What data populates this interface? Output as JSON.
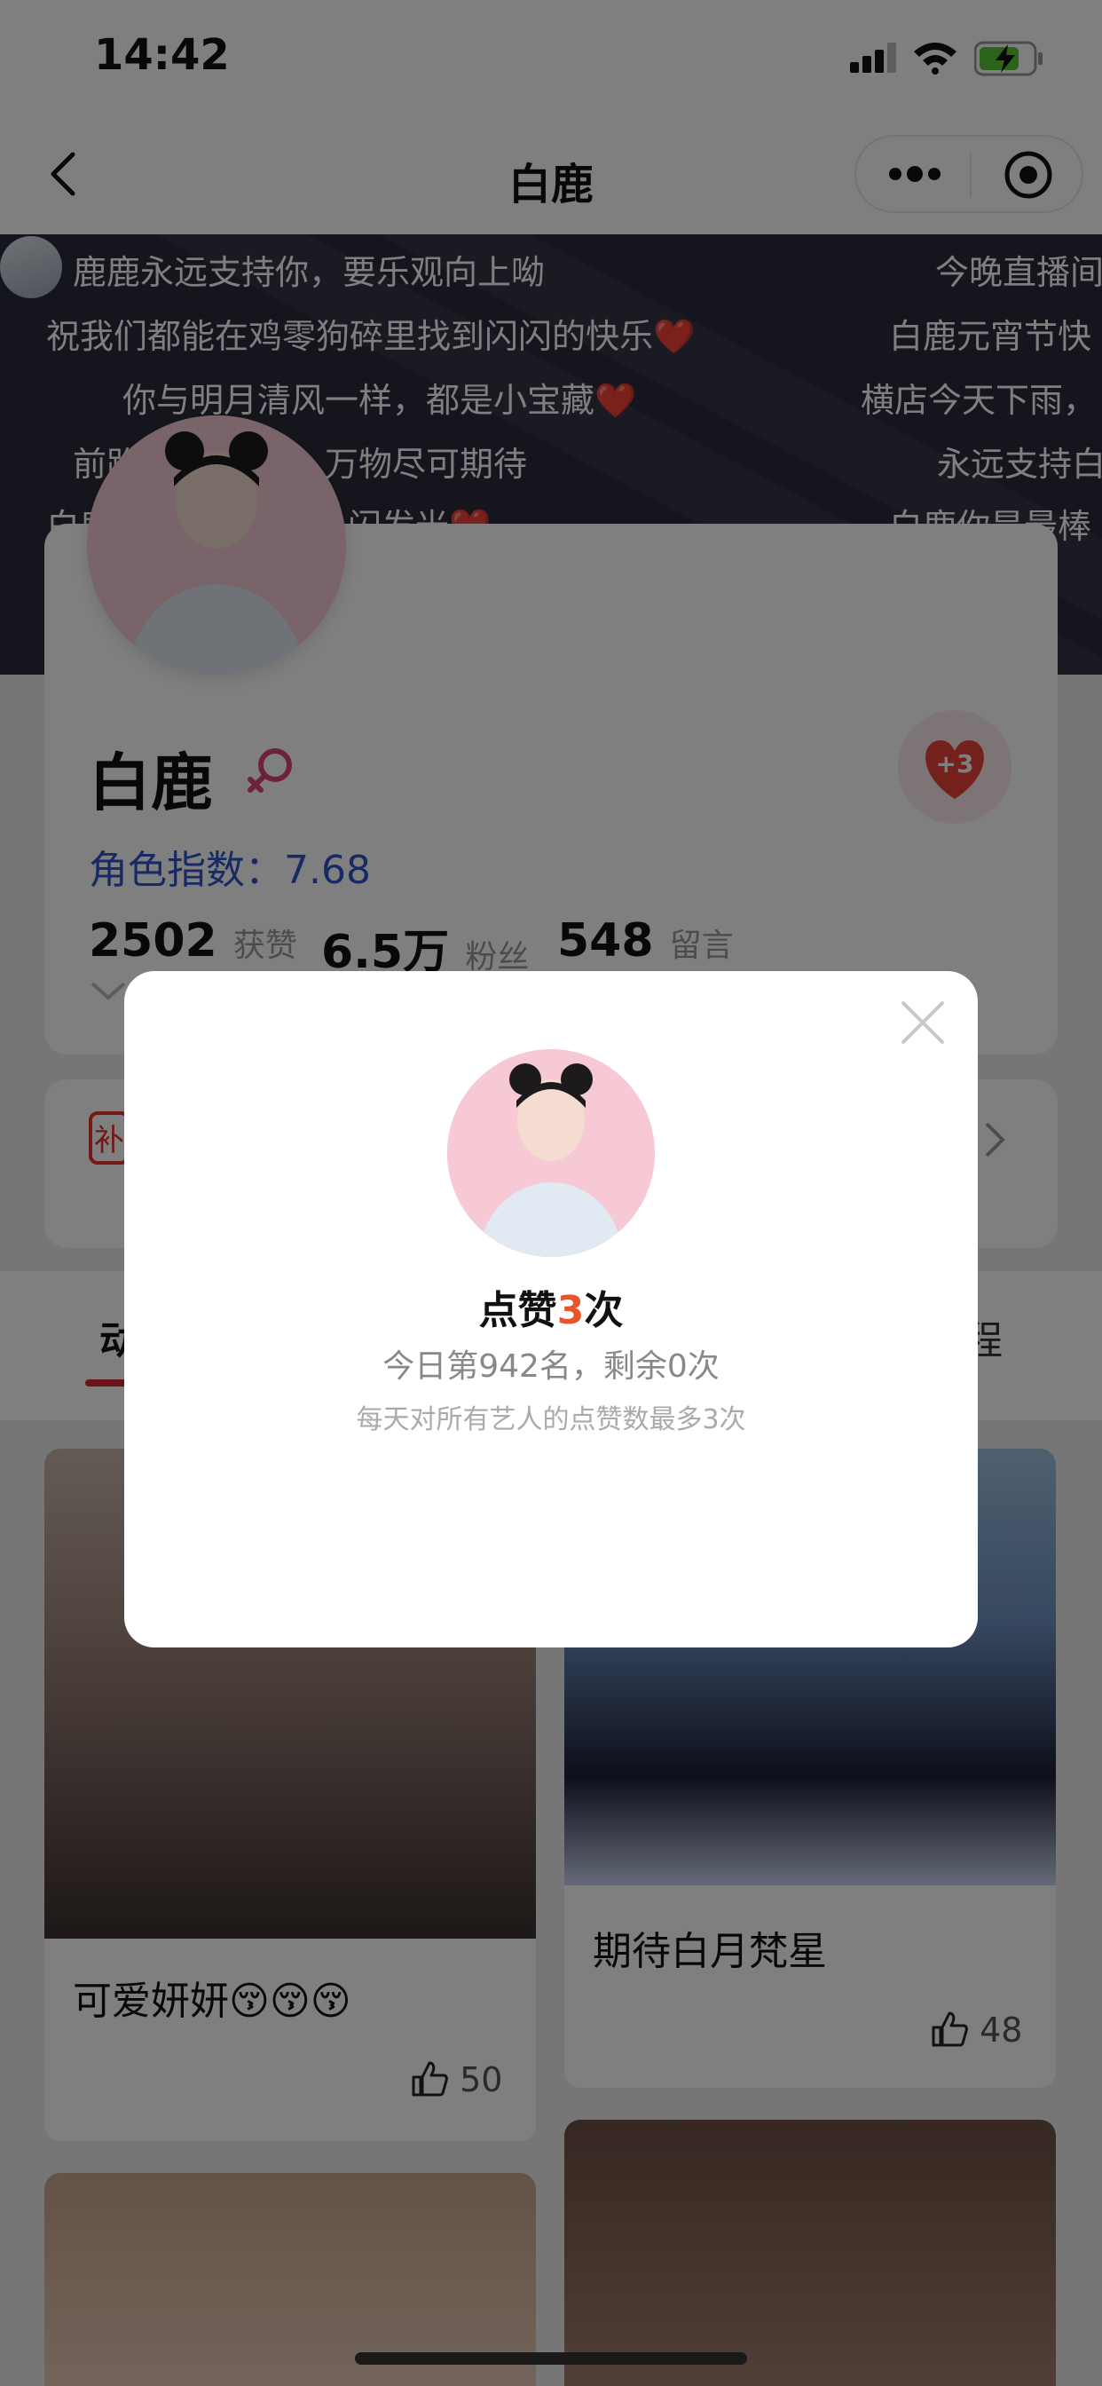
{
  "status_bar": {
    "time": "14:42"
  },
  "nav": {
    "title": "白鹿"
  },
  "danmaku": [
    "鹿鹿永远支持你，要乐观向上呦",
    "今晚直播间",
    "祝我们都能在鸡零狗碎里找到闪闪的快乐❤️",
    "白鹿元宵节快",
    "你与明月清风一样，都是小宝藏❤️",
    "横店今天下雨，",
    "前路",
    "万物尽可期待",
    "永远支持白",
    "白鹿",
    "闪发光❤️",
    "白鹿你是最棒"
  ],
  "profile": {
    "name": "白鹿",
    "heart_badge": "+3",
    "role_index_label": "角色指数：",
    "role_index_value": "7.68",
    "stats": [
      {
        "value": "2502",
        "label": "获赞"
      },
      {
        "value": "6.5万",
        "label": "粉丝"
      },
      {
        "value": "548",
        "label": "留言"
      }
    ]
  },
  "tabs": {
    "first": "动",
    "last": "程"
  },
  "tag_label": "补",
  "feed": [
    {
      "caption": "可爱妍妍😚😚😚",
      "likes": "50"
    },
    {
      "caption": "期待白月梵星",
      "likes": "48"
    }
  ],
  "modal": {
    "title_prefix": "点赞",
    "title_count": "3",
    "title_suffix": "次",
    "rank_text": "今日第942名，剩余0次",
    "note": "每天对所有艺人的点赞数最多3次"
  },
  "colors": {
    "accent_red": "#d8262d",
    "index_blue": "#2f55c8",
    "count_orange": "#e8552b"
  }
}
